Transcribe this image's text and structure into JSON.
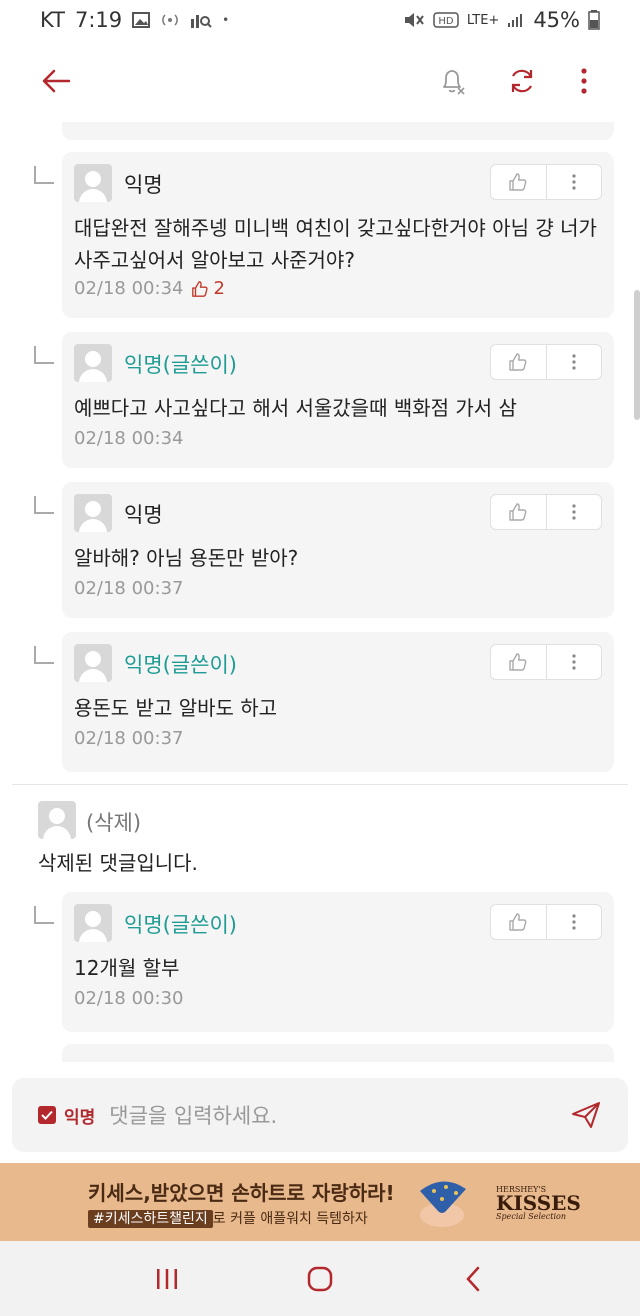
{
  "status_bar": {
    "carrier": "KT",
    "time": "7:19",
    "dot": "•",
    "network": "LTE+",
    "battery": "45%"
  },
  "app_bar": {
    "back_icon": "arrow-left-icon",
    "notify_icon": "bell-off-icon",
    "refresh_icon": "refresh-icon",
    "more_icon": "more-vertical-icon"
  },
  "comments": [
    {
      "name": "익명",
      "is_author": false,
      "text": "대답완전 잘해주넹 미니백 여친이 갖고싶다한거야 아님 걍 너가 사주고싶어서 알아보고 사준거야?",
      "time": "02/18 00:34",
      "likes": "2"
    },
    {
      "name": "익명(글쓴이)",
      "is_author": true,
      "text": "예쁘다고 사고싶다고 해서 서울갔을때 백화점 가서 삼",
      "time": "02/18 00:34",
      "likes": ""
    },
    {
      "name": "익명",
      "is_author": false,
      "text": "알바해? 아님 용돈만 받아?",
      "time": "02/18 00:37",
      "likes": ""
    },
    {
      "name": "익명(글쓴이)",
      "is_author": true,
      "text": "용돈도 받고 알바도 하고",
      "time": "02/18 00:37",
      "likes": ""
    }
  ],
  "deleted_parent": {
    "name": "(삭제)",
    "text": "삭제된 댓글입니다."
  },
  "reply_after_deleted": {
    "name": "익명(글쓴이)",
    "text": "12개월 할부",
    "time": "02/18 00:30"
  },
  "input": {
    "anon_label": "익명",
    "placeholder": "댓글을 입력하세요."
  },
  "ad": {
    "headline": "키세스,받았으면 손하트로 자랑하라!",
    "hashtag": "#키세스하트챌린지",
    "subline": "로 커플 애플워치 득템하자",
    "brand_small": "HERSHEY'S",
    "brand_big": "KISSES",
    "brand_sel": "Special Selection"
  },
  "colors": {
    "accent_red": "#b3282d",
    "author_teal": "#1e9c94",
    "card_bg": "#f5f5f5"
  }
}
